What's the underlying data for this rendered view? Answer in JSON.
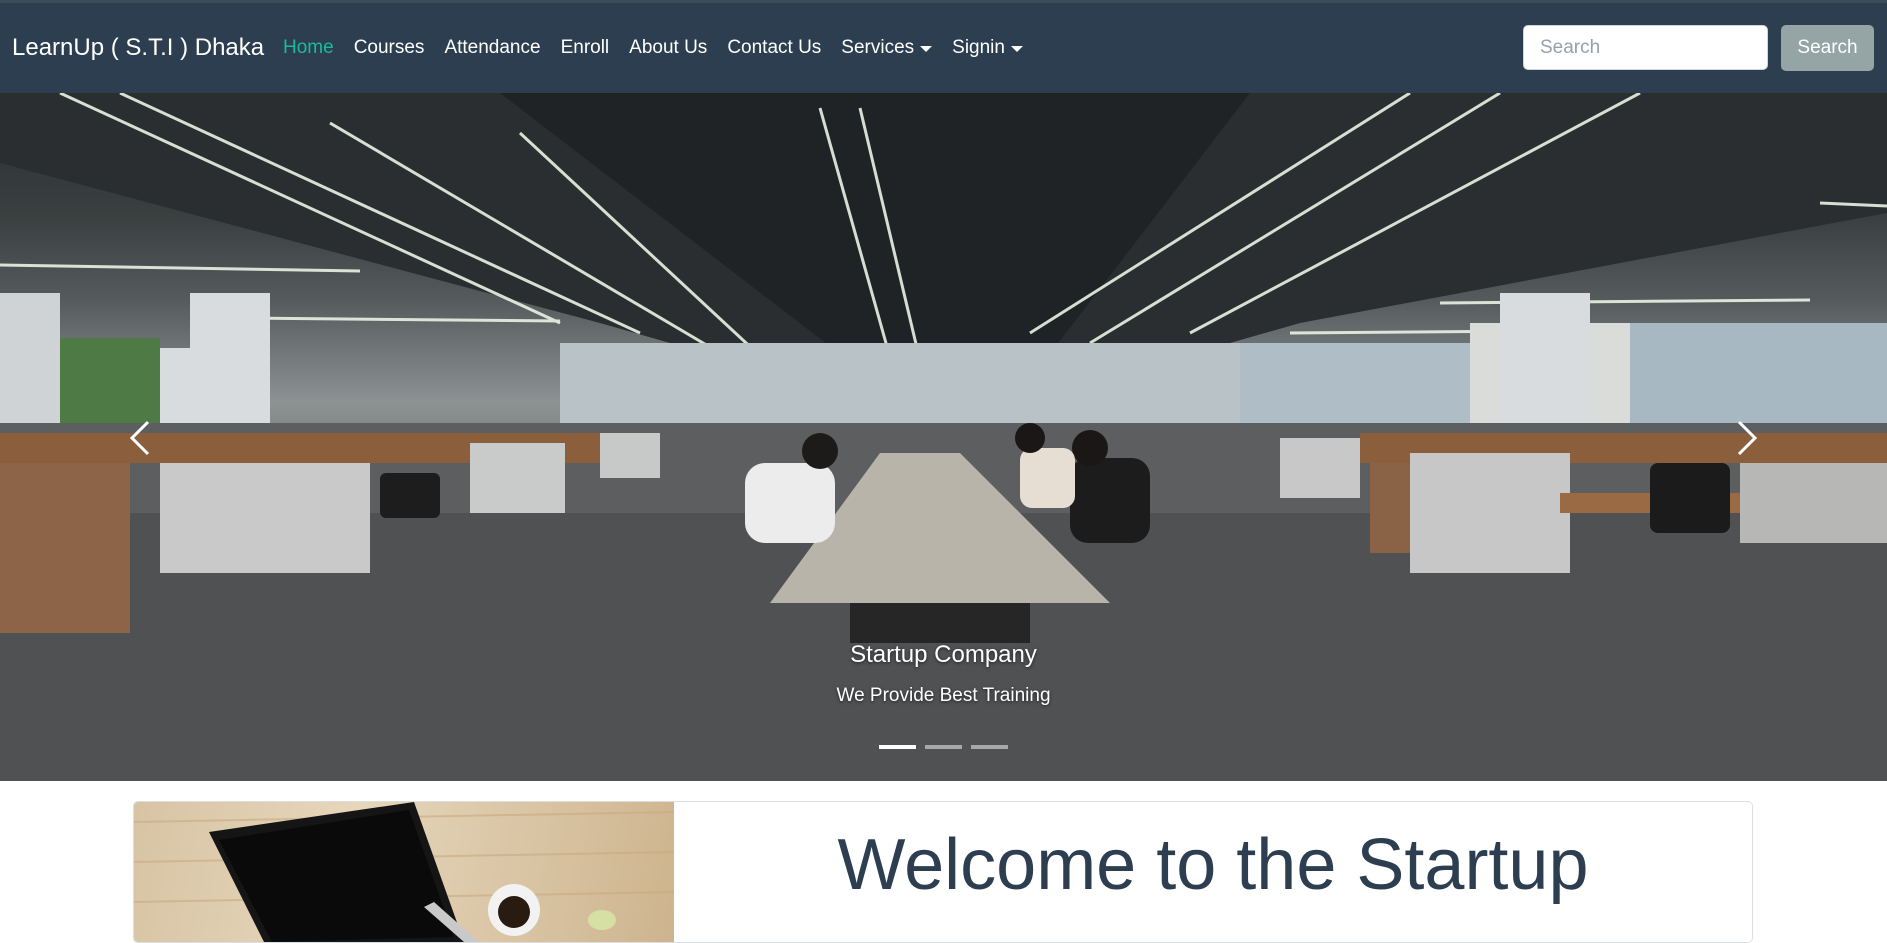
{
  "navbar": {
    "brand": "LearnUp ( S.T.I ) Dhaka",
    "links": [
      {
        "label": "Home",
        "active": true
      },
      {
        "label": "Courses"
      },
      {
        "label": "Attendance"
      },
      {
        "label": "Enroll"
      },
      {
        "label": "About Us"
      },
      {
        "label": "Contact Us"
      },
      {
        "label": "Services",
        "dropdown": true
      },
      {
        "label": "Signin",
        "dropdown": true
      }
    ],
    "search": {
      "placeholder": "Search",
      "button_label": "Search"
    }
  },
  "hero": {
    "slide_title": "Startup Company",
    "slide_text": "We Provide Best Training",
    "slide_count": 3,
    "active_slide": 1,
    "prev_icon": "chevron-left-icon",
    "next_icon": "chevron-right-icon"
  },
  "welcome": {
    "title": "Welcome to the Startup"
  },
  "colors": {
    "navbar_bg": "#2c3e50",
    "active_link": "#18bc9c",
    "search_button_bg": "#95a5a6",
    "title_text": "#2c3e50"
  }
}
